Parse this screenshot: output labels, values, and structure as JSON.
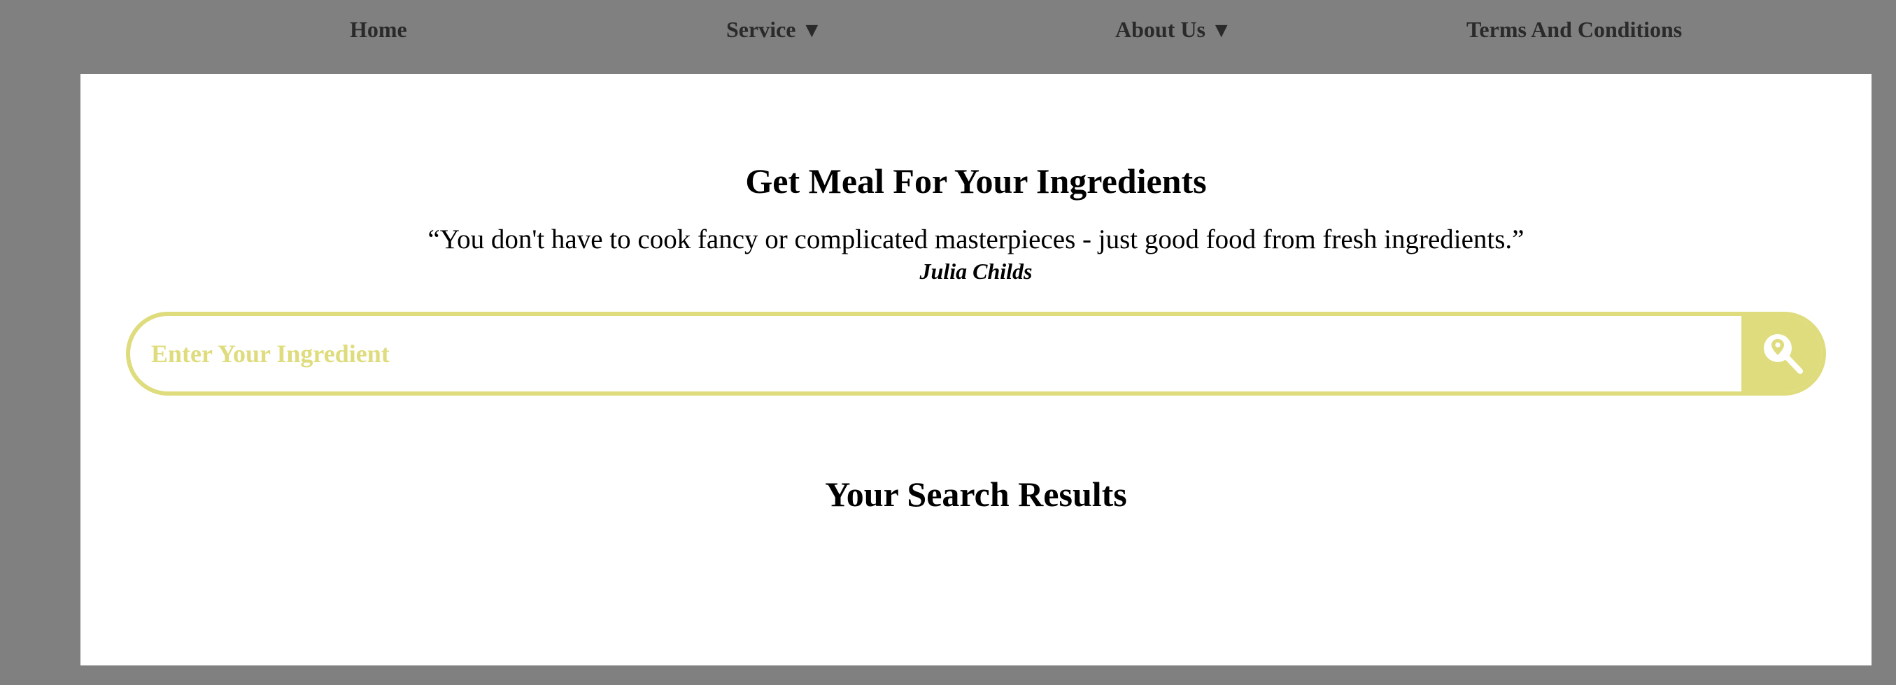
{
  "nav": {
    "home": "Home",
    "service": "Service",
    "about": "About Us",
    "terms": "Terms And Conditions",
    "caret": "▼"
  },
  "main": {
    "heading": "Get Meal For Your Ingredients",
    "quote": "“You don't have to cook fancy or complicated masterpieces - just good food from fresh ingredients.”",
    "author": "Julia Childs",
    "search": {
      "placeholder": "Enter Your Ingredient",
      "value": "",
      "button_icon": "search-location-icon"
    },
    "results_heading": "Your Search Results"
  },
  "colors": {
    "page_background": "#808080",
    "panel_background": "#ffffff",
    "accent": "#dedc7c"
  }
}
